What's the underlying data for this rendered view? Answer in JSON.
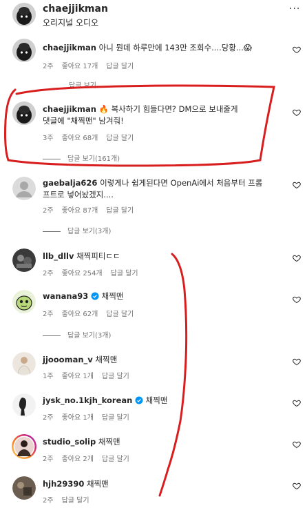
{
  "header": {
    "username": "chaejjikman",
    "subtitle": "오리지널 오디오",
    "more": "···"
  },
  "comments": [
    {
      "user": "chaejjikman",
      "text": "아니 뭔데 하루만에 143만 조회수....당황...😱",
      "age": "2주",
      "likes": "좋아요 17개",
      "reply": "답글 달기",
      "view_replies": "답글 보기"
    },
    {
      "user": "chaejjikman",
      "text_line1": "🔥 복사하기 힘들다면? DM으로 보내줄게",
      "text_line2": "댓글에 \"채찍맨\" 남겨줘!",
      "age": "3주",
      "likes": "좋아요 68개",
      "reply": "답글 달기",
      "view_replies": "답글 보기(161개)"
    },
    {
      "user": "gaebalja626",
      "text_line1": "이렇게나 쉽게된다면 OpenAi에서 처음부터 프롬",
      "text_line2": "프트로 넣어놨겠지....",
      "age": "2주",
      "likes": "좋아요 87개",
      "reply": "답글 달기",
      "view_replies": "답글 보기(3개)"
    },
    {
      "user": "llb_dllv",
      "text": "채찍피티ㄷㄷ",
      "age": "2주",
      "likes": "좋아요 254개",
      "reply": "답글 달기"
    },
    {
      "user": "wanana93",
      "text": "채찍맨",
      "age": "2주",
      "likes": "좋아요 62개",
      "reply": "답글 달기",
      "view_replies": "답글 보기(3개)"
    },
    {
      "user": "jjoooman_v",
      "text": "채찍맨",
      "age": "1주",
      "likes": "좋아요 1개",
      "reply": "답글 달기"
    },
    {
      "user": "jysk_no.1kjh_korean",
      "text": "채찍맨",
      "age": "2주",
      "likes": "좋아요 1개",
      "reply": "답글 달기"
    },
    {
      "user": "studio_solip",
      "text": "채찍맨",
      "age": "2주",
      "likes": "좋아요 2개",
      "reply": "답글 달기"
    },
    {
      "user": "hjh29390",
      "text": "채찍맨",
      "age": "2주",
      "reply": "답글 달기"
    }
  ],
  "colors": {
    "annotation_red": "#d81e1e",
    "meta_gray": "#737373",
    "verified_blue": "#0095f6"
  }
}
